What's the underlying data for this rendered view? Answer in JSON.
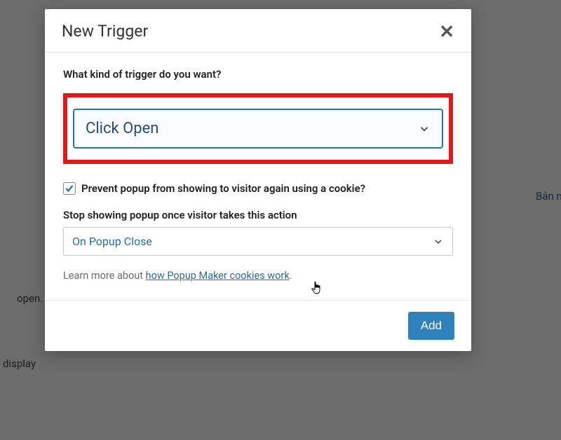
{
  "background": {
    "text1": "open.",
    "text2": "display",
    "text3": "Bản nh"
  },
  "modal": {
    "title": "New Trigger",
    "question": "What kind of trigger do you want?",
    "trigger_select": "Click Open",
    "checkbox_label": "Prevent popup from showing to visitor again using a cookie?",
    "checkbox_checked": true,
    "stop_label": "Stop showing popup once visitor takes this action",
    "stop_select": "On Popup Close",
    "learn_prefix": "Learn more about ",
    "learn_link": "how Popup Maker cookies work",
    "learn_suffix": ".",
    "add_button": "Add"
  }
}
